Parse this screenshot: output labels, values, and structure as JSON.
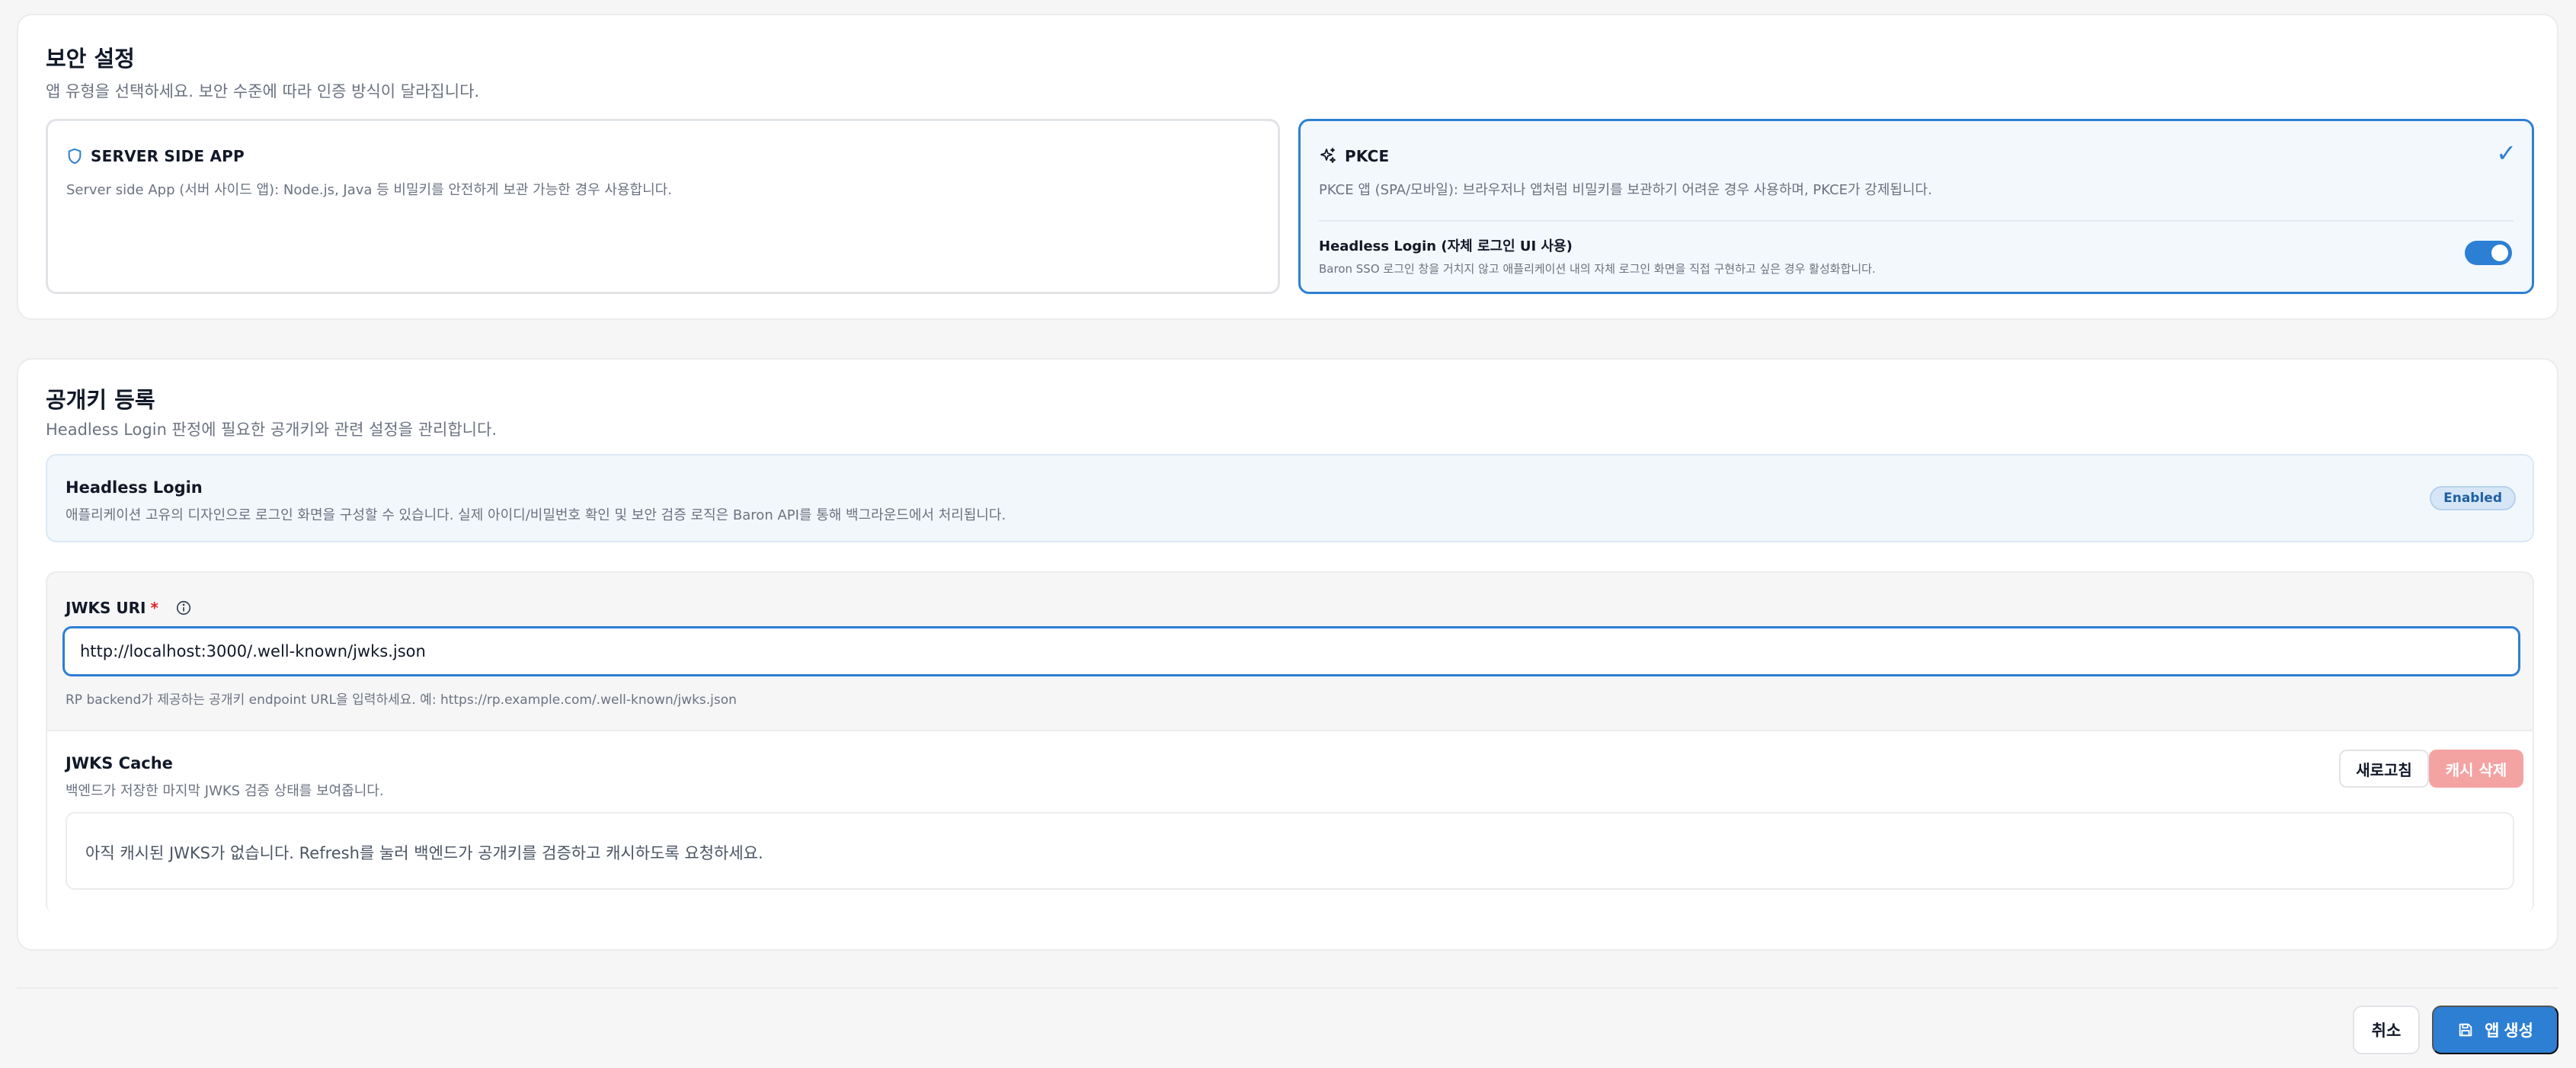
{
  "security": {
    "title": "보안 설정",
    "subtitle": "앱 유형을 선택하세요. 보안 수준에 따라 인증 방식이 달라집니다.",
    "options": [
      {
        "title": "SERVER SIDE APP",
        "description": "Server side App (서버 사이드 앱): Node.js, Java 등 비밀키를 안전하게 보관 가능한 경우 사용합니다.",
        "icon": "shield-icon",
        "selected": false
      },
      {
        "title": "PKCE",
        "description": "PKCE 앱 (SPA/모바일): 브라우저나 앱처럼 비밀키를 보관하기 어려운 경우 사용하며, PKCE가 강제됩니다.",
        "icon": "sparkles-icon",
        "selected": true,
        "check": "✓"
      }
    ],
    "headless": {
      "title": "Headless Login (자체 로그인 UI 사용)",
      "description": "Baron SSO 로그인 창을 거치지 않고 애플리케이션 내의 자체 로그인 화면을 직접 구현하고 싶은 경우 활성화합니다.",
      "enabled": true
    }
  },
  "keys": {
    "title": "공개키 등록",
    "subtitle": "Headless Login 판정에 필요한 공개키와 관련 설정을 관리합니다.",
    "headless_box": {
      "title": "Headless Login",
      "description": "애플리케이션 고유의 디자인으로 로그인 화면을 구성할 수 있습니다. 실제 아이디/비밀번호 확인 및 보안 검증 로직은 Baron API를 통해 백그라운드에서 처리됩니다.",
      "badge": "Enabled"
    },
    "jwks": {
      "label": "JWKS URI",
      "required_mark": "*",
      "value": "http://localhost:3000/.well-known/jwks.json",
      "help": "RP backend가 제공하는 공개키 endpoint URL을 입력하세요. 예: https://rp.example.com/.well-known/jwks.json"
    },
    "cache": {
      "title": "JWKS Cache",
      "description": "백엔드가 저장한 마지막 JWKS 검증 상태를 보여줍니다.",
      "refresh_label": "새로고침",
      "clear_label": "캐시 삭제",
      "empty_text": "아직 캐시된 JWKS가 없습니다. Refresh를 눌러 백엔드가 공개키를 검증하고 캐시하도록 요청하세요."
    }
  },
  "footer": {
    "cancel_label": "취소",
    "create_label": "앱 생성",
    "create_icon": "save-icon"
  },
  "colors": {
    "accent": "#2d7fd4",
    "danger_disabled": "#f4a3a3",
    "badge_bg": "#d6e6f7"
  }
}
